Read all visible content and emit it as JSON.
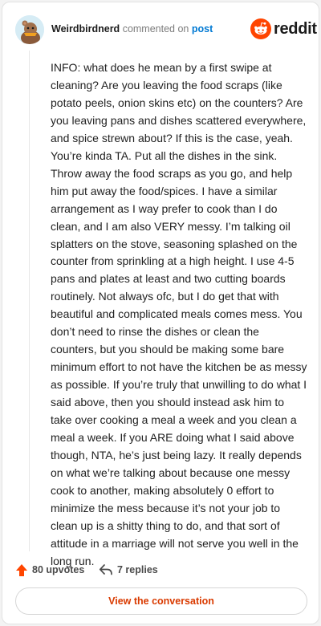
{
  "header": {
    "username": "Weirdbirdnerd",
    "action_text": "commented on",
    "post_link_text": "post",
    "brand_name": "reddit",
    "brand_color": "#ff4500"
  },
  "comment": {
    "text": "INFO: what does he mean by a first swipe at cleaning? Are you leaving the food scraps (like potato peels, onion skins etc) on the counters? Are you leaving pans and dishes scattered everywhere, and spice strewn about? If this is the case, yeah. You’re kinda TA. Put all the dishes in the sink. Throw away the food scraps as you go, and help him put away the food/spices. I have a similar arrangement as I way prefer to cook than I do clean, and I am also VERY messy. I’m talking oil splatters on the stove, seasoning splashed on the counter from sprinkling at a high height. I use 4-5 pans and plates at least and two cutting boards routinely. Not always ofc, but I do get that with beautiful and complicated meals comes mess. You don’t need to rinse the dishes or clean the counters, but you should be making some bare minimum effort to not have the kitchen be as messy as possible. If you’re truly that unwilling to do what I said above, then you should instead ask him to take over cooking a meal a week and you clean a meal a week. If you ARE doing what I said above though, NTA, he’s just being lazy. It really depends on what we’re talking about because one messy cook to another, making absolutely 0 effort to minimize the mess because it’s not your job to clean up is a shitty thing to do, and that sort of attitude in a marriage will not serve you well in the long run."
  },
  "actions": {
    "upvotes_label": "80 upvotes",
    "replies_label": "7 replies",
    "upvote_icon": "upvote-arrow-icon",
    "reply_icon": "reply-arrow-icon"
  },
  "footer": {
    "view_button_label": "View the conversation"
  }
}
